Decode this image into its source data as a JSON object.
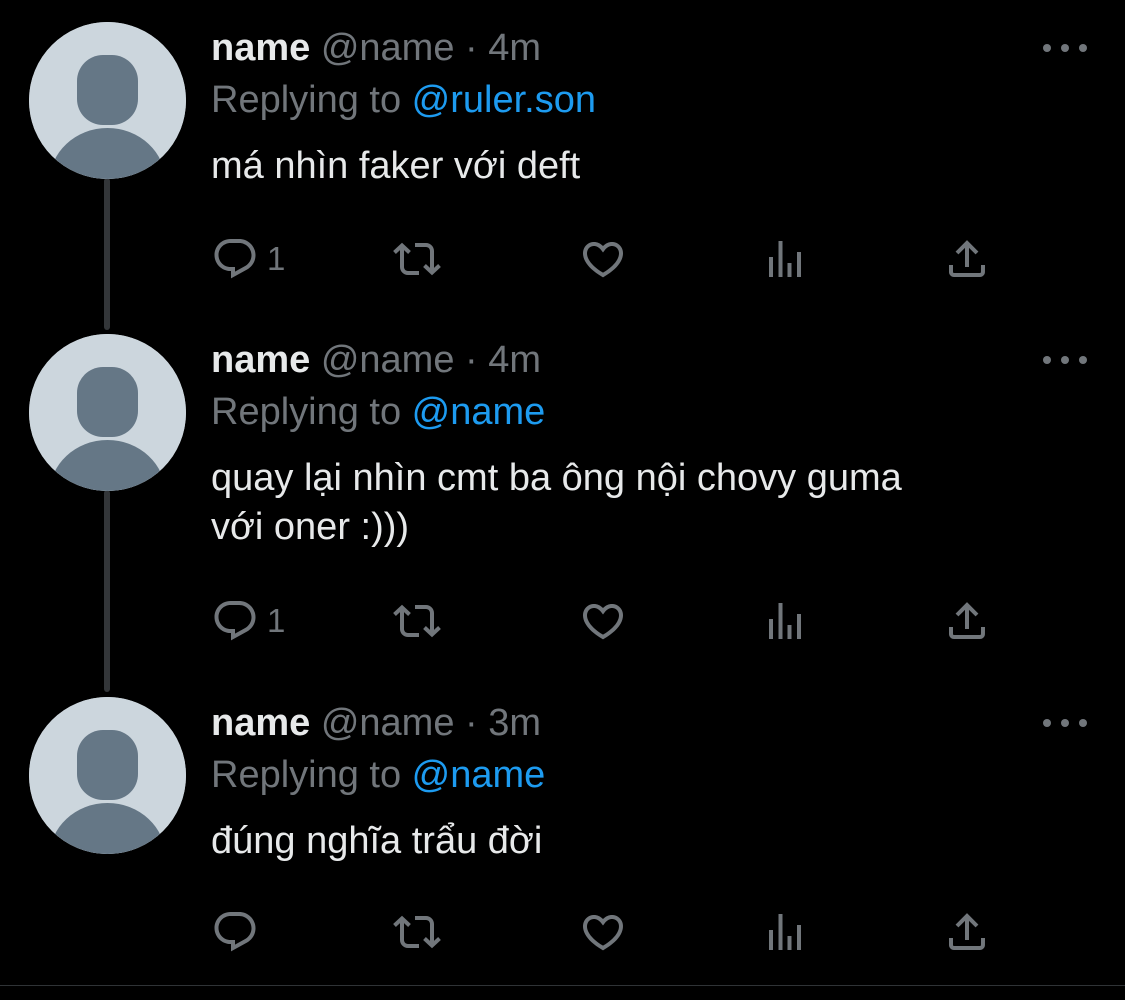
{
  "colors": {
    "background": "#000000",
    "primary_text": "#e7e9ea",
    "secondary_text": "#71767b",
    "mention": "#1d9bf0",
    "avatar_bg": "#ccd6dd",
    "avatar_fg": "#657786"
  },
  "tweets": [
    {
      "display_name": "name",
      "handle": "@name",
      "separator": "·",
      "time": "4m",
      "reply_prefix": "Replying to ",
      "reply_to": "@ruler.son",
      "text": "má nhìn faker với deft",
      "reply_count": "1",
      "icons": [
        "reply-icon",
        "retweet-icon",
        "like-icon",
        "analytics-icon",
        "share-icon",
        "more-icon"
      ]
    },
    {
      "display_name": "name",
      "handle": "@name",
      "separator": "·",
      "time": "4m",
      "reply_prefix": "Replying to ",
      "reply_to": "@name",
      "text": "quay lại nhìn cmt ba ông nội chovy guma\nvới oner :)))",
      "reply_count": "1",
      "icons": [
        "reply-icon",
        "retweet-icon",
        "like-icon",
        "analytics-icon",
        "share-icon",
        "more-icon"
      ]
    },
    {
      "display_name": "name",
      "handle": "@name",
      "separator": "·",
      "time": "3m",
      "reply_prefix": "Replying to ",
      "reply_to": "@name",
      "text": "đúng nghĩa trẩu đời",
      "reply_count": "",
      "icons": [
        "reply-icon",
        "retweet-icon",
        "like-icon",
        "analytics-icon",
        "share-icon",
        "more-icon"
      ]
    }
  ]
}
